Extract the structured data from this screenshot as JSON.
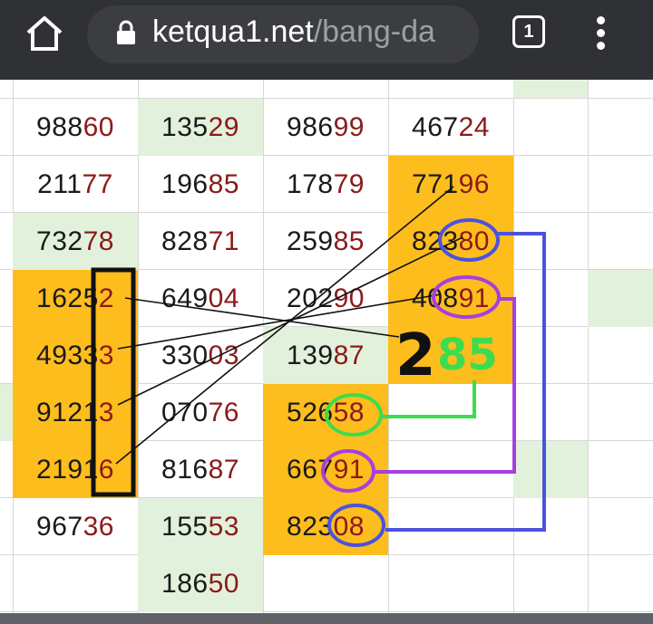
{
  "browser": {
    "url_host": "ketqua1.net",
    "url_path": "/bang-da",
    "tab_count": "1",
    "icons": [
      "home-icon",
      "lock-icon",
      "tab-switcher-icon",
      "more-vert-icon"
    ]
  },
  "table": {
    "columns": [
      [
        {
          "head": "988",
          "tail": "60",
          "bg": "white"
        },
        {
          "head": "211",
          "tail": "77",
          "bg": "white"
        },
        {
          "head": "732",
          "tail": "78",
          "bg": "green"
        },
        {
          "head": "1625",
          "tail": "2",
          "bg": "orange"
        },
        {
          "head": "4933",
          "tail": "3",
          "bg": "orange"
        },
        {
          "head": "9121",
          "tail": "3",
          "bg": "orange"
        },
        {
          "head": "2191",
          "tail": "6",
          "bg": "orange"
        },
        {
          "head": "967",
          "tail": "36",
          "bg": "white"
        }
      ],
      [
        {
          "head": "135",
          "tail": "29",
          "bg": "green"
        },
        {
          "head": "196",
          "tail": "85",
          "bg": "white"
        },
        {
          "head": "828",
          "tail": "71",
          "bg": "white"
        },
        {
          "head": "649",
          "tail": "04",
          "bg": "white"
        },
        {
          "head": "330",
          "tail": "03",
          "bg": "white"
        },
        {
          "head": "070",
          "tail": "76",
          "bg": "white"
        },
        {
          "head": "816",
          "tail": "87",
          "bg": "white"
        },
        {
          "head": "155",
          "tail": "53",
          "bg": "green"
        },
        {
          "head": "186",
          "tail": "50",
          "bg": "white"
        }
      ],
      [
        {
          "head": "986",
          "tail": "99",
          "bg": "white"
        },
        {
          "head": "178",
          "tail": "79",
          "bg": "white"
        },
        {
          "head": "259",
          "tail": "85",
          "bg": "white"
        },
        {
          "head": "202",
          "tail": "90",
          "bg": "white"
        },
        {
          "head": "139",
          "tail": "87",
          "bg": "green"
        },
        {
          "head": "526",
          "tail": "58",
          "bg": "orange"
        },
        {
          "head": "667",
          "tail": "91",
          "bg": "orange"
        },
        {
          "head": "823",
          "tail": "08",
          "bg": "orange"
        }
      ],
      [
        {
          "head": "467",
          "tail": "24",
          "bg": "white"
        },
        {
          "head": "771",
          "tail": "96",
          "bg": "orange"
        },
        {
          "head": "823",
          "tail": "80",
          "bg": "orange"
        },
        {
          "head": "408",
          "tail": "91",
          "bg": "orange"
        },
        {
          "head": "",
          "tail": "",
          "bg": "orange"
        }
      ]
    ]
  },
  "annotations": {
    "big_digit": "2",
    "green_digits": "85",
    "colors": {
      "black": "#111111",
      "blue": "#4a52e0",
      "purple": "#a63fe0",
      "green": "#3ddc4e",
      "cell_orange": "#fdbd1d",
      "cell_green": "#e2f1dc",
      "tail_red": "#8b1a1a"
    }
  }
}
